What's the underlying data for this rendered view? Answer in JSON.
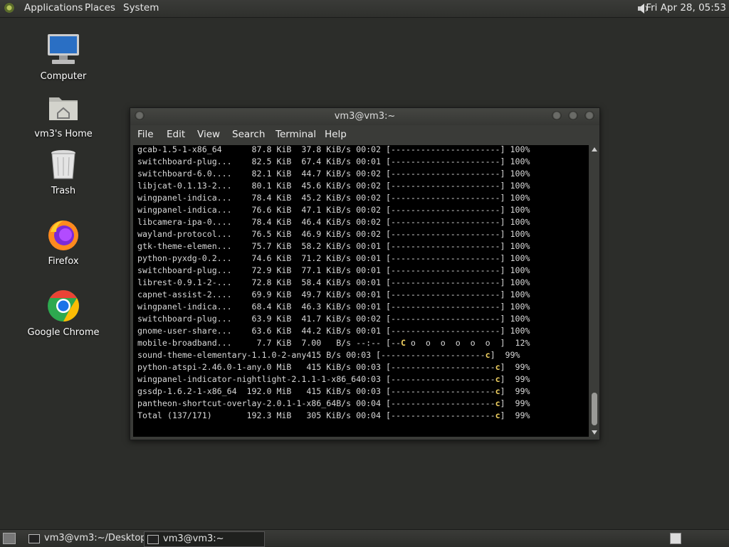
{
  "top_panel": {
    "menus": [
      "Applications",
      "Places",
      "System"
    ],
    "clock": "Fri Apr 28, 05:53"
  },
  "desktop_icons": [
    {
      "label": "Computer",
      "icon": "computer-icon"
    },
    {
      "label": "vm3's Home",
      "icon": "home-folder-icon"
    },
    {
      "label": "Trash",
      "icon": "trash-icon"
    },
    {
      "label": "Firefox",
      "icon": "firefox-icon"
    },
    {
      "label": "Google Chrome",
      "icon": "chrome-icon"
    }
  ],
  "terminal": {
    "title": "vm3@vm3:~",
    "menu": [
      "File",
      "Edit",
      "View",
      "Search",
      "Terminal",
      "Help"
    ],
    "lines": [
      "gcab-1.5-1-x86_64      87.8 KiB  37.8 KiB/s 00:02 [----------------------] 100%",
      "switchboard-plug...    82.5 KiB  67.4 KiB/s 00:01 [----------------------] 100%",
      "switchboard-6.0....    82.1 KiB  44.7 KiB/s 00:02 [----------------------] 100%",
      "libjcat-0.1.13-2...    80.1 KiB  45.6 KiB/s 00:02 [----------------------] 100%",
      "wingpanel-indica...    78.4 KiB  45.2 KiB/s 00:02 [----------------------] 100%",
      "wingpanel-indica...    76.6 KiB  47.1 KiB/s 00:02 [----------------------] 100%",
      "libcamera-ipa-0....    78.4 KiB  46.4 KiB/s 00:02 [----------------------] 100%",
      "wayland-protocol...    76.5 KiB  46.9 KiB/s 00:02 [----------------------] 100%",
      "gtk-theme-elemen...    75.7 KiB  58.2 KiB/s 00:01 [----------------------] 100%",
      "python-pyxdg-0.2...    74.6 KiB  71.2 KiB/s 00:01 [----------------------] 100%",
      "switchboard-plug...    72.9 KiB  77.1 KiB/s 00:01 [----------------------] 100%",
      "librest-0.9.1-2-...    72.8 KiB  58.4 KiB/s 00:01 [----------------------] 100%",
      "capnet-assist-2....    69.9 KiB  49.7 KiB/s 00:01 [----------------------] 100%",
      "wingpanel-indica...    68.4 KiB  46.3 KiB/s 00:01 [----------------------] 100%",
      "switchboard-plug...    63.9 KiB  41.7 KiB/s 00:02 [----------------------] 100%",
      "gnome-user-share...    63.6 KiB  44.2 KiB/s 00:01 [----------------------] 100%"
    ],
    "partial_lines": [
      {
        "pre": "mobile-broadband...     7.7 KiB  7.00   B/s --:-- [--",
        "mark": "C",
        "post": " o  o  o  o  o  o  ]  12%"
      },
      {
        "pre": "sound-theme-elementary-1.1.0-2-any415 B/s 00:03 [---------------------",
        "mark": "c",
        "post": "]  99%"
      },
      {
        "pre": "python-atspi-2.46.0-1-any.0 MiB   415 KiB/s 00:03 [---------------------",
        "mark": "c",
        "post": "]  99%"
      },
      {
        "pre": "wingpanel-indicator-nightlight-2.1.1-1-x86_640:03 [---------------------",
        "mark": "c",
        "post": "]  99%"
      },
      {
        "pre": "gssdp-1.6.2-1-x86_64  192.0 MiB   415 KiB/s 00:03 [---------------------",
        "mark": "c",
        "post": "]  99%"
      },
      {
        "pre": "pantheon-shortcut-overlay-2.0.1-1-x86_64B/s 00:04 [---------------------",
        "mark": "c",
        "post": "]  99%"
      },
      {
        "pre": "Total (137/171)       192.3 MiB   305 KiB/s 00:04 [---------------------",
        "mark": "c",
        "post": "]  99%"
      }
    ]
  },
  "taskbar": {
    "tasks": [
      "vm3@vm3:~/Desktop",
      "vm3@vm3:~"
    ]
  }
}
